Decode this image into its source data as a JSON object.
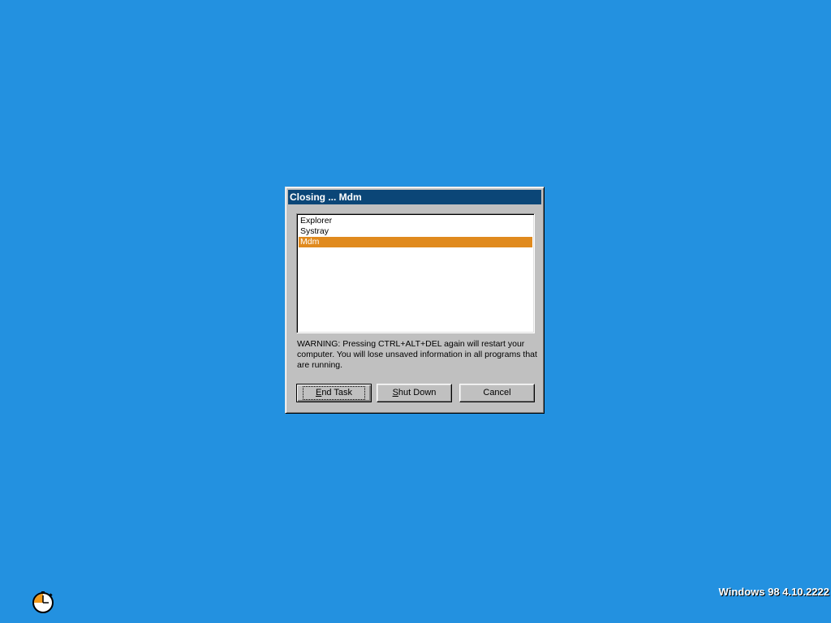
{
  "desktop": {
    "background_color": "#2391e0",
    "version_text": "Windows 98 4.10.2222",
    "busy_icon": "clock-hourglass-icon"
  },
  "dialog": {
    "title": "Closing ... Mdm",
    "title_bar_color": "#0b4677",
    "processes": [
      {
        "label": "Explorer",
        "selected": false
      },
      {
        "label": "Systray",
        "selected": false
      },
      {
        "label": "Mdm",
        "selected": true
      }
    ],
    "selection_color": "#e08a1e",
    "warning_text": "WARNING: Pressing CTRL+ALT+DEL again will restart your computer. You will lose unsaved information in all programs that are running.",
    "buttons": {
      "end_task": {
        "prefix": "",
        "accel": "E",
        "rest": "nd Task"
      },
      "shut_down": {
        "prefix": "",
        "accel": "S",
        "rest": "hut Down"
      },
      "cancel": {
        "label": "Cancel"
      }
    }
  }
}
